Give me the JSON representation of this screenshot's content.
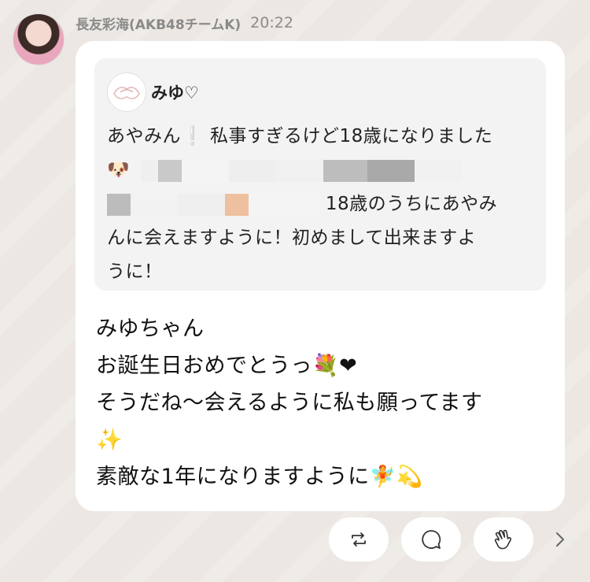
{
  "message": {
    "sender": "長友彩海(AKB48チームK)",
    "time": "20:22",
    "quote": {
      "name": "みゆ♡",
      "line1": "あやみん❕ 私事すぎるけど18歳になりました",
      "line2_emoji": "🐶",
      "line3_tail": "18歳のうちにあやみ",
      "line4": "んに会えますように！初めまして出来ますよ",
      "line5": "うに！"
    },
    "reply": {
      "line1": "みゆちゃん",
      "line2": "お誕生日おめでとうっ💐❤",
      "line3": "そうだね〜会えるように私も願ってます",
      "line4": "✨",
      "line5": "素敵な1年になりますように🧚💫"
    }
  },
  "actions": {
    "repost_icon": "repost-icon",
    "comment_icon": "comment-icon",
    "clap_icon": "clap-icon",
    "more_icon": "chevron-right-icon"
  },
  "colors": {
    "background": "#ece7e2",
    "bubble": "#ffffff",
    "quote_bg": "#f4f3f3",
    "meta_text": "#8a8a8a"
  }
}
